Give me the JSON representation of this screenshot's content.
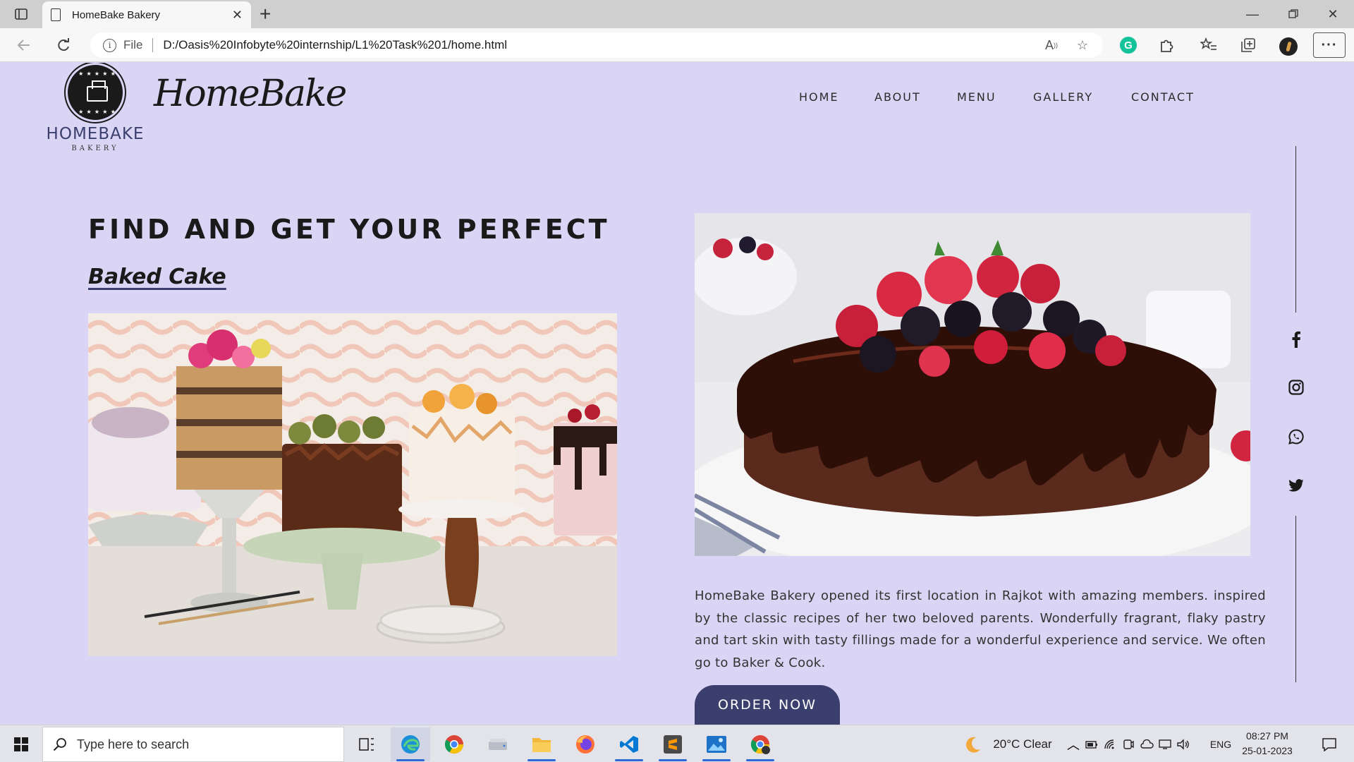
{
  "browser": {
    "tab_title": "HomeBake Bakery",
    "url_scheme": "File",
    "url": "D:/Oasis%20Infobyte%20internship/L1%20Task%201/home.html"
  },
  "site": {
    "logo_name": "HOMEBAKE",
    "logo_tagline": "BAKERY",
    "script_logo": "HomeBake",
    "nav": [
      "HOME",
      "ABOUT",
      "MENU",
      "GALLERY",
      "CONTACT"
    ],
    "heading": "FIND AND GET YOUR PERFECT",
    "subheading": "Baked Cake",
    "description": "HomeBake Bakery opened its first location in Rajkot with amazing members. inspired by the classic recipes of her two beloved parents. Wonderfully fragrant, flaky pastry and tart skin with tasty fillings made for a wonderful experience and service. We often go to Baker & Cook.",
    "order_button": "ORDER NOW",
    "social_icons": [
      "facebook-icon",
      "instagram-icon",
      "whatsapp-icon",
      "twitter-icon"
    ]
  },
  "taskbar": {
    "search_placeholder": "Type here to search",
    "weather": "20°C  Clear",
    "language": "ENG",
    "time": "08:27 PM",
    "date": "25-01-2023"
  },
  "colors": {
    "page_bg": "#dad5f5",
    "accent": "#3b3f6e",
    "text_dark": "#1a1a1a"
  }
}
